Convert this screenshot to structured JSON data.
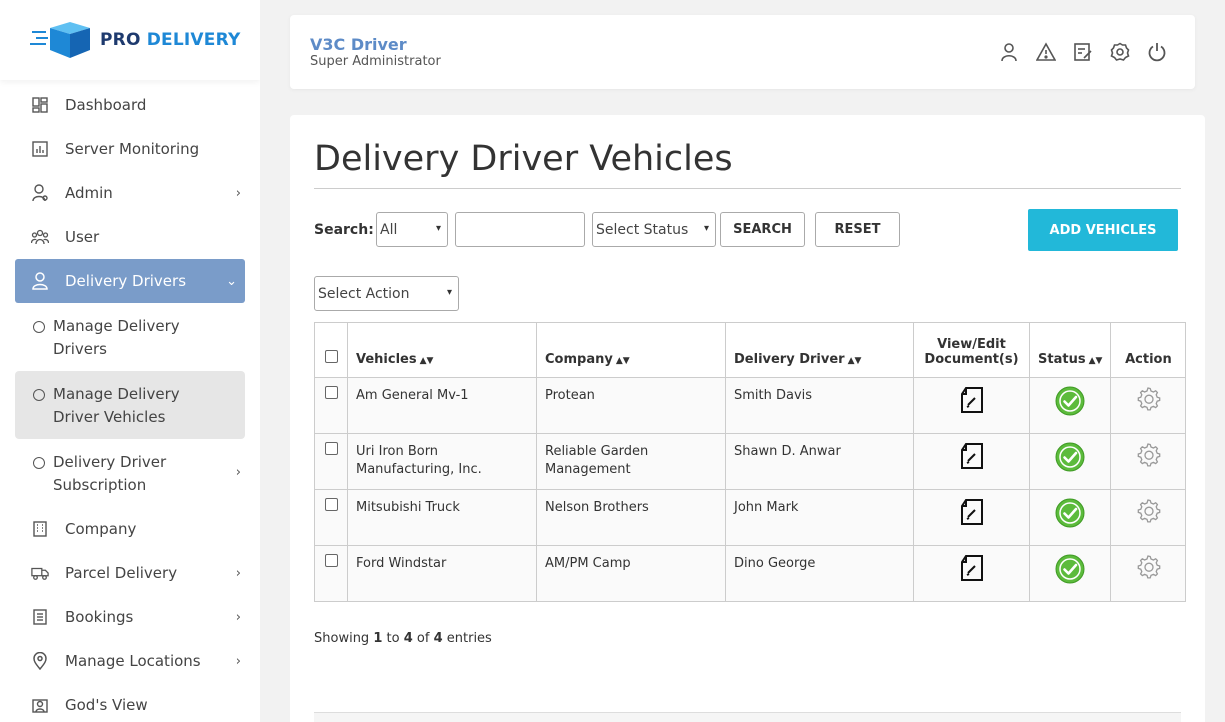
{
  "brand": {
    "part1": "PRO",
    "part2": "DELIVERY"
  },
  "sidebar": {
    "items": [
      {
        "label": "Dashboard"
      },
      {
        "label": "Server Monitoring"
      },
      {
        "label": "Admin"
      },
      {
        "label": "User"
      },
      {
        "label": "Delivery Drivers"
      },
      {
        "label": "Company"
      },
      {
        "label": "Parcel Delivery"
      },
      {
        "label": "Bookings"
      },
      {
        "label": "Manage Locations"
      },
      {
        "label": "God's View"
      }
    ],
    "sub_items": [
      {
        "line1": "Manage Delivery",
        "line2": "Drivers"
      },
      {
        "line1": "Manage Delivery",
        "line2": "Driver Vehicles"
      },
      {
        "line1": "Delivery Driver",
        "line2": "Subscription"
      }
    ],
    "accent_color": "#7a9cc9"
  },
  "header": {
    "user_name": "V3C Driver",
    "user_role": "Super Administrator"
  },
  "main": {
    "title": "Delivery Driver Vehicles",
    "search_label": "Search:",
    "filter_select": "All",
    "search_value": "",
    "status_select": "Select Status",
    "search_button": "SEARCH",
    "reset_button": "RESET",
    "add_button": "ADD VEHICLES",
    "action_select": "Select Action",
    "columns": {
      "vehicles": "Vehicles",
      "company": "Company",
      "driver": "Delivery Driver",
      "doc_line1": "View/Edit",
      "doc_line2": "Document(s)",
      "status": "Status",
      "action": "Action"
    },
    "rows": [
      {
        "vehicle": "Am General Mv-1",
        "company": "Protean",
        "driver": "Smith Davis"
      },
      {
        "vehicle": "Uri Iron Born Manufacturing, Inc.",
        "company": "Reliable Garden Management",
        "driver": "Shawn D. Anwar"
      },
      {
        "vehicle": "Mitsubishi Truck",
        "company": "Nelson Brothers",
        "driver": "John Mark"
      },
      {
        "vehicle": "Ford Windstar",
        "company": "AM/PM Camp",
        "driver": "Dino George"
      }
    ],
    "showing": {
      "prefix": "Showing",
      "from": "1",
      "to_word": "to",
      "to": "4",
      "of_word": "of",
      "total": "4",
      "suffix": "entries"
    },
    "add_button_color": "#22b8d9",
    "status_color": "#5cbb3c"
  }
}
